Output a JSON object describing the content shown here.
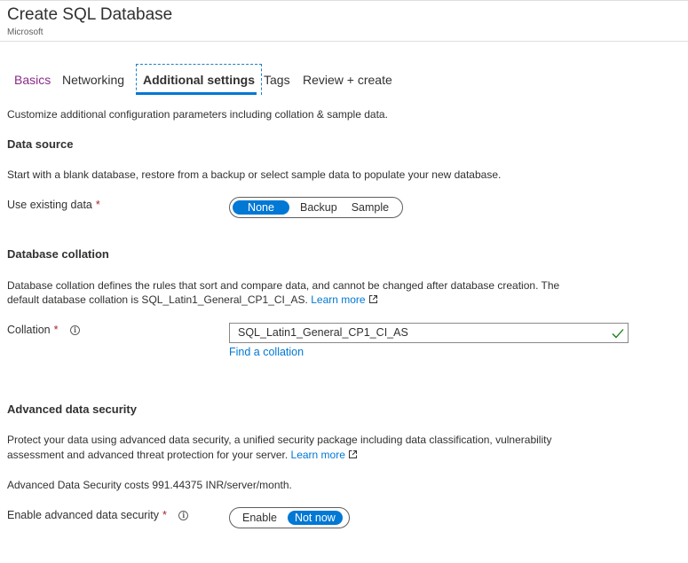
{
  "header": {
    "title": "Create SQL Database",
    "subtitle": "Microsoft"
  },
  "tabs": [
    {
      "label": "Basics",
      "state": "visited"
    },
    {
      "label": "Networking",
      "state": "normal"
    },
    {
      "label": "Additional settings",
      "state": "active"
    },
    {
      "label": "Tags",
      "state": "normal"
    },
    {
      "label": "Review + create",
      "state": "normal"
    }
  ],
  "intro": "Customize additional configuration parameters including collation & sample data.",
  "data_source": {
    "heading": "Data source",
    "description": "Start with a blank database, restore from a backup or select sample data to populate your new database.",
    "field_label": "Use existing data",
    "required_mark": "*",
    "options": [
      "None",
      "Backup",
      "Sample"
    ],
    "selected": "None"
  },
  "collation": {
    "heading": "Database collation",
    "description_line1": "Database collation defines the rules that sort and compare data, and cannot be changed after database creation. The",
    "description_line2": "default database collation is SQL_Latin1_General_CP1_CI_AS.",
    "learn_more": "Learn more",
    "field_label": "Collation",
    "required_mark": "*",
    "value": "SQL_Latin1_General_CP1_CI_AS",
    "find_link": "Find a collation"
  },
  "security": {
    "heading": "Advanced data security",
    "description_line1": "Protect your data using advanced data security, a unified security package including data classification, vulnerability",
    "description_line2": "assessment and advanced threat protection for your server.",
    "learn_more": "Learn more",
    "cost": "Advanced Data Security costs 991.44375 INR/server/month.",
    "field_label": "Enable advanced data security",
    "required_mark": "*",
    "options": [
      "Enable",
      "Not now"
    ],
    "selected": "Not now"
  },
  "colors": {
    "accent": "#0078d4",
    "visited_tab": "#8a2a8a",
    "required": "#a4262c",
    "valid_check": "#107c10"
  }
}
